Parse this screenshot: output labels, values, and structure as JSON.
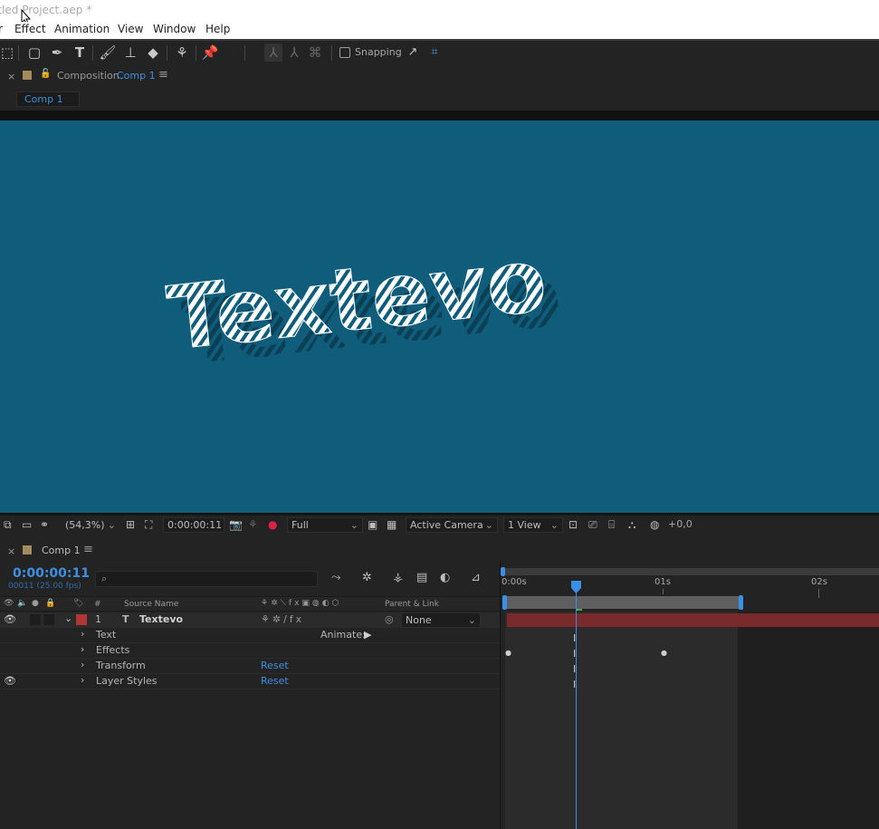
{
  "window": {
    "title": "itled Project.aep *"
  },
  "menu": [
    "r",
    "Effect",
    "Animation",
    "View",
    "Window",
    "Help"
  ],
  "toolbar": {
    "snapping_label": "Snapping",
    "tools": [
      "selection-icon",
      "rectangle-icon",
      "pen-icon",
      "type-icon",
      "brush-icon",
      "clone-stamp-icon",
      "eraser-icon",
      "roto-brush-icon",
      "puppet-pin-icon"
    ]
  },
  "composition_panel": {
    "prefix": "Composition",
    "name": "Comp 1",
    "tab_label": "Comp 1",
    "canvas_bg": "#0f5d7a",
    "canvas_text": "Textevo"
  },
  "viewer_bar": {
    "zoom": "(54,3%)",
    "timecode": "0:00:00:11",
    "resolution": "Full",
    "camera": "Active Camera",
    "views": "1 View",
    "exposure": "+0,0"
  },
  "timeline": {
    "tab_label": "Comp 1",
    "current_time": "0:00:00:11",
    "frame_info": "00011 (25.00 fps)",
    "search_placeholder": "",
    "columns": {
      "num": "#",
      "source": "Source Name",
      "parent": "Parent & Link"
    },
    "ruler_labels": [
      "0:00s",
      "01s",
      "02s"
    ],
    "layer": {
      "number": "1",
      "type_glyph": "T",
      "name": "Textevo",
      "parent": "None",
      "label_color": "#b23636"
    },
    "properties": [
      {
        "name": "Text",
        "extra": "Animate:"
      },
      {
        "name": "Effects",
        "extra": ""
      },
      {
        "name": "Transform",
        "extra": "Reset"
      },
      {
        "name": "Layer Styles",
        "extra": "Reset"
      }
    ],
    "playhead_fraction": 0.44
  }
}
